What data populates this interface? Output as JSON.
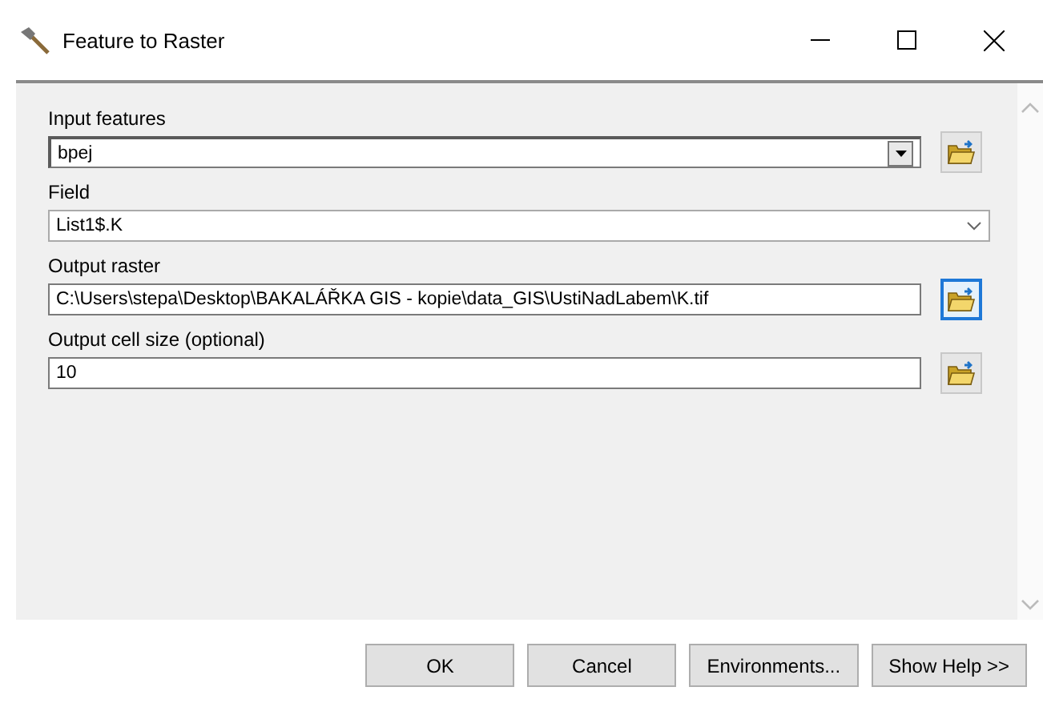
{
  "window": {
    "title": "Feature to Raster"
  },
  "parameters": [
    {
      "label": "Input features",
      "kind": "dropdown",
      "value": "bpej",
      "browse": true,
      "focused": false
    },
    {
      "label": "Field",
      "kind": "combo",
      "value": "List1$.K",
      "browse": false
    },
    {
      "label": "Output raster",
      "kind": "text",
      "value": "C:\\Users\\stepa\\Desktop\\BAKALÁŘKA GIS - kopie\\data_GIS\\UstiNadLabem\\K.tif",
      "browse": true,
      "focused": true
    },
    {
      "label": "Output cell size (optional)",
      "kind": "text",
      "value": "10",
      "browse": true,
      "focused": false
    }
  ],
  "buttons": [
    "OK",
    "Cancel",
    "Environments...",
    "Show Help >>"
  ]
}
